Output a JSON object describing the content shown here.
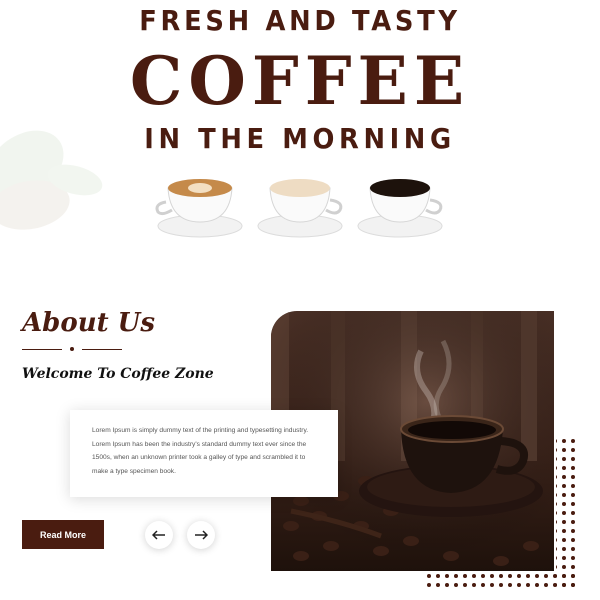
{
  "hero": {
    "line1": "FRESH AND TASTY",
    "line2": "COFFEE",
    "line3": "IN THE MORNING"
  },
  "cups": [
    {
      "name": "latte-art-cup-icon"
    },
    {
      "name": "cappuccino-cup-icon"
    },
    {
      "name": "black-coffee-cup-icon"
    }
  ],
  "about": {
    "title": "About Us",
    "subtitle": "Welcome To Coffee Zone",
    "body_lines": [
      "Lorem Ipsum is simply dummy text of the printing and typesetting industry.",
      "Lorem Ipsum has been the industry's standard dummy text ever since the",
      "1500s, when an unknown printer took a galley of type and scrambled it to",
      "make a type specimen book."
    ],
    "read_more_label": "Read More"
  },
  "nav": {
    "prev_icon": "arrow-left-icon",
    "next_icon": "arrow-right-icon"
  },
  "colors": {
    "brand": "#4a1c10",
    "card_bg": "#ffffff",
    "dots": "#4a1c10"
  }
}
